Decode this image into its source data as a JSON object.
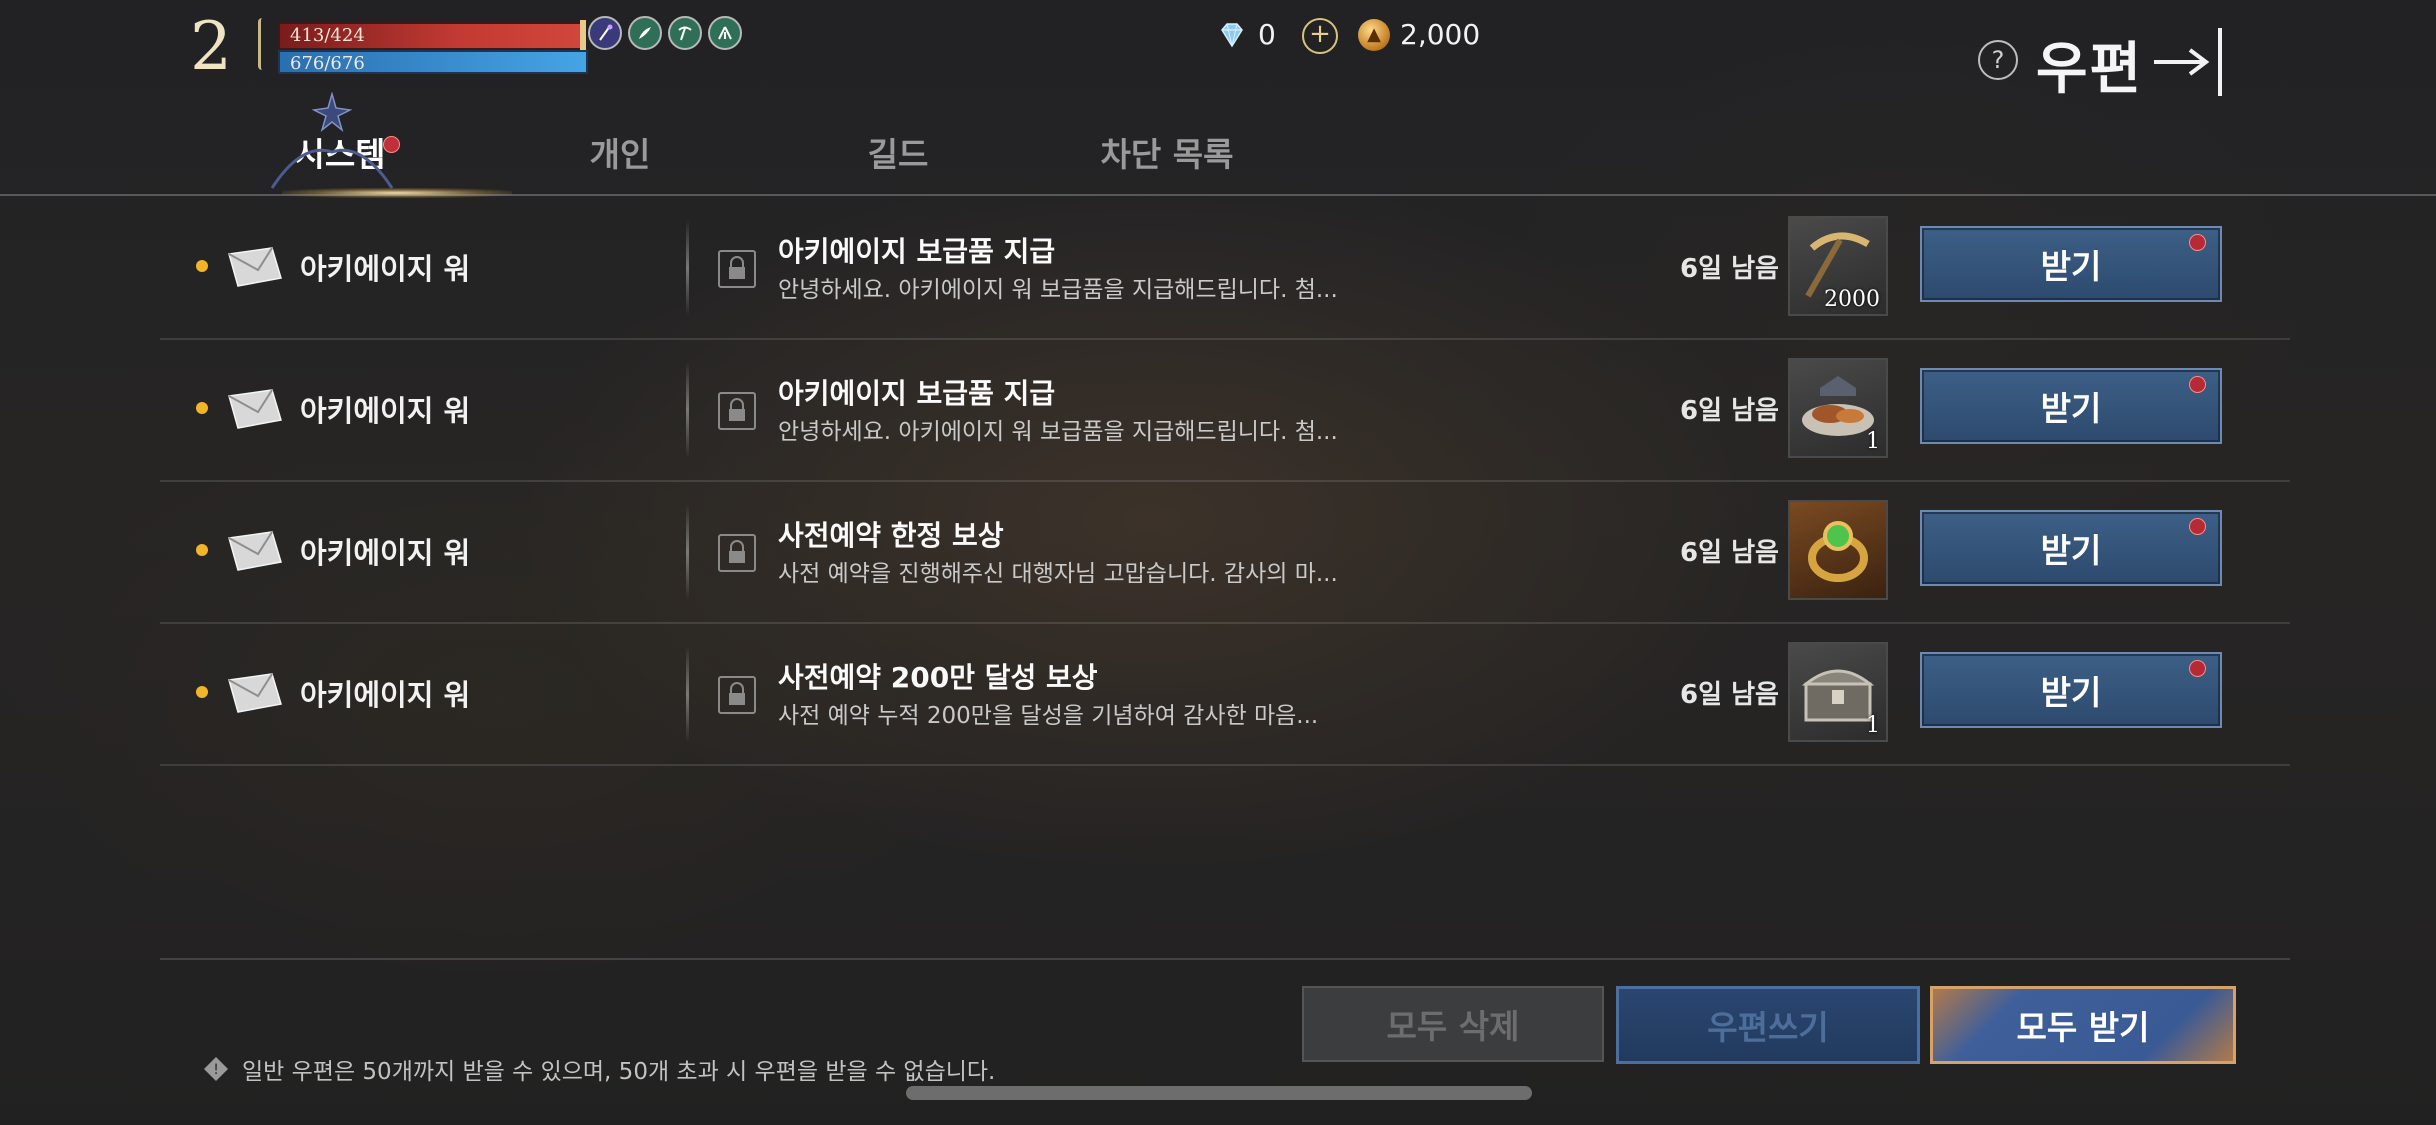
{
  "hud": {
    "level": "2",
    "hp_text": "413/424",
    "mp_text": "676/676",
    "buffs": [
      "staff-buff-icon",
      "feather-buff-icon",
      "pickaxe-buff-icon",
      "tent-buff-icon"
    ]
  },
  "currency": {
    "diamond": "0",
    "gold": "2,000"
  },
  "header": {
    "title": "우편"
  },
  "tabs": [
    {
      "label": "시스템",
      "active": true,
      "has_notification": true
    },
    {
      "label": "개인",
      "active": false
    },
    {
      "label": "길드",
      "active": false
    },
    {
      "label": "차단 목록",
      "active": false
    }
  ],
  "mails": [
    {
      "sender": "아키에이지 워",
      "title": "아키에이지 보급품 지급",
      "preview": "안녕하세요. 아키에이지 워 보급품을 지급해드립니다. 첨...",
      "remain": "6일 남음",
      "item": "pickaxe-icon",
      "count": "2000",
      "button": "받기"
    },
    {
      "sender": "아키에이지 워",
      "title": "아키에이지 보급품 지급",
      "preview": "안녕하세요. 아키에이지 워 보급품을 지급해드립니다. 첨...",
      "remain": "6일 남음",
      "item": "food-platter-icon",
      "count": "1",
      "button": "받기"
    },
    {
      "sender": "아키에이지 워",
      "title": "사전예약 한정 보상",
      "preview": "사전 예약을 진행해주신 대행자님 고맙습니다. 감사의 마...",
      "remain": "6일 남음",
      "item": "emerald-ring-icon",
      "count": "",
      "button": "받기"
    },
    {
      "sender": "아키에이지 워",
      "title": "사전예약 200만 달성 보상",
      "preview": "사전 예약 누적 200만을 달성을 기념하여 감사한 마음...",
      "remain": "6일 남음",
      "item": "treasure-chest-icon",
      "count": "1",
      "button": "받기"
    }
  ],
  "footer": {
    "delete_all": "모두 삭제",
    "write_mail": "우편쓰기",
    "receive_all": "모두 받기",
    "notice": "일반 우편은 50개까지 받을 수 있으며, 50개 초과 시 우편을 받을 수 없습니다."
  },
  "colors": {
    "accent_gold": "#f1b52a",
    "button_blue": "#2d4a6e",
    "notify_red": "#c0303a"
  }
}
